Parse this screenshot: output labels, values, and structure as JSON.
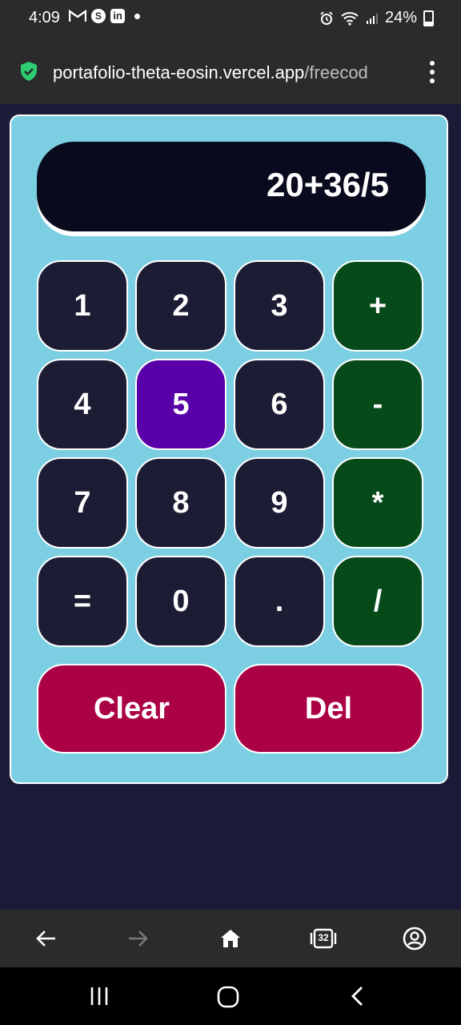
{
  "status_bar": {
    "time": "4:09",
    "battery": "24%",
    "notification_icons": [
      "gmail-icon",
      "skype-icon",
      "linkedin-icon",
      "dot-icon"
    ],
    "system_icons": [
      "alarm-icon",
      "wifi-icon",
      "signal-icon",
      "battery-icon"
    ]
  },
  "browser": {
    "url_host": "portafolio-theta-eosin.vercel.app",
    "url_path": "/freecod",
    "security_icon": "shield-check-icon",
    "menu_icon": "more-vert-icon",
    "tab_count": "32"
  },
  "calculator": {
    "display": "20+36/5",
    "rows": [
      [
        "1",
        "2",
        "3",
        "+"
      ],
      [
        "4",
        "5",
        "6",
        "-"
      ],
      [
        "7",
        "8",
        "9",
        "*"
      ],
      [
        "=",
        "0",
        ".",
        "/"
      ]
    ],
    "active_key": "5",
    "clear_label": "Clear",
    "delete_label": "Del"
  },
  "colors": {
    "page_bg": "#1c1b37",
    "card_bg": "#7ccfe2",
    "key_bg": "#1c1c35",
    "operator_bg": "#064a1a",
    "active_bg": "#5a00a8",
    "action_bg": "#ab0246",
    "display_bg": "#0a0a1e"
  }
}
